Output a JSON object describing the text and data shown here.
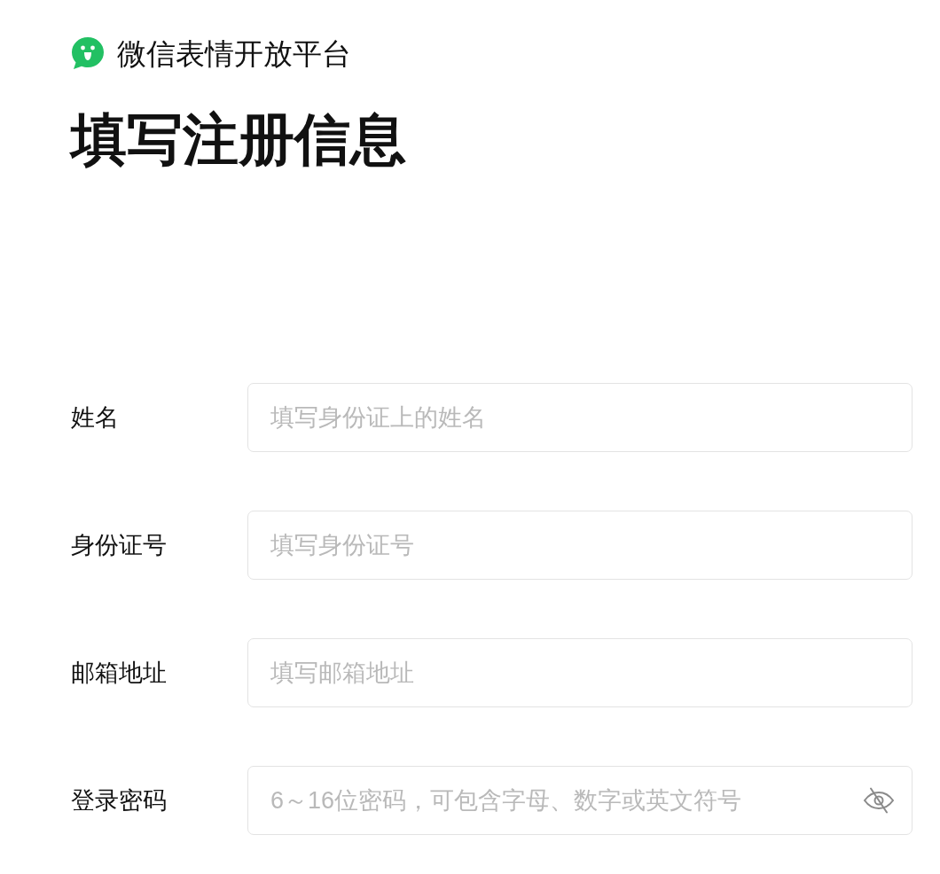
{
  "brand": {
    "name": "微信表情开放平台"
  },
  "page_title": "填写注册信息",
  "form": {
    "fields": [
      {
        "kind": "text",
        "label": "姓名",
        "placeholder": "填写身份证上的姓名"
      },
      {
        "kind": "text",
        "label": "身份证号",
        "placeholder": "填写身份证号"
      },
      {
        "kind": "text",
        "label": "邮箱地址",
        "placeholder": "填写邮箱地址"
      },
      {
        "kind": "password",
        "label": "登录密码",
        "placeholder": "6～16位密码，可包含字母、数字或英文符号"
      }
    ]
  }
}
